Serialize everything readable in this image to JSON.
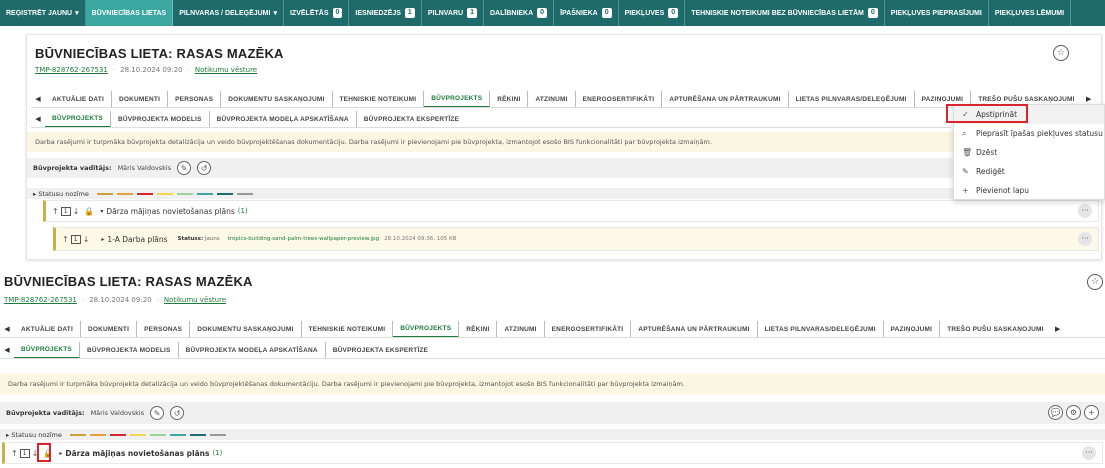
{
  "topnav": {
    "items": [
      {
        "label": "Reģistrēt jaunu",
        "caret": true
      },
      {
        "label": "Būvniecības lietas",
        "active": true
      },
      {
        "label": "Pilnvaras / deleģējumi",
        "caret": true
      },
      {
        "label": "Izvēlētās",
        "count": "0"
      },
      {
        "label": "Iesniedzējs",
        "count": "1"
      },
      {
        "label": "Pilnvaru",
        "count": "1"
      },
      {
        "label": "Dalībnieka",
        "count": "0"
      },
      {
        "label": "Īpašnieka",
        "count": "0"
      },
      {
        "label": "Piekļuves",
        "count": "0"
      },
      {
        "label": "Tehniskie noteikumi bez būvniecības lietām",
        "count": "0"
      },
      {
        "label": "Piekļuves pieprasījumi"
      },
      {
        "label": "Piekļuves lēmumi"
      }
    ],
    "caret_glyph": "▾"
  },
  "case": {
    "title": "Būvniecības lieta: Rasas Mazēka",
    "id": "TMP-828762-267531",
    "date": "28.10.2024 09:20",
    "history_link": "Notikumu vēsture",
    "sep": "·"
  },
  "tabs": {
    "main": [
      "Aktuālie dati",
      "Dokumenti",
      "Personas",
      "Dokumentu saskaņojumi",
      "Tehniskie noteikumi",
      "Būvprojekts",
      "Rēķini",
      "Atzinumi",
      "Energosertifikāti",
      "Apturēšana un pārtraukumi",
      "Lietas pilnvaras/deleģējumi",
      "Paziņojumi",
      "Trešo pušu saskaņojumi"
    ],
    "sub": [
      "Būvprojekts",
      "Būvprojekta modelis",
      "Būvprojekta modeļa apskatīšana",
      "Būvprojekta ekspertīze"
    ],
    "left_arrow": "◀",
    "right_arrow": "▶"
  },
  "info_text": "Darba rasējumi ir turpmāka būvprojekta detalizācija un veido būvprojektēšanas dokumentāciju. Darba rasējumi ir pievienojami pie būvprojekta, izmantojot esošo BIS funkcionalitāti par būvprojekta izmaiņām.",
  "manager": {
    "label": "Būvprojekta vadītājs:",
    "name": "Māris Valdovskis"
  },
  "legend": {
    "label": "▸ Statusu nozīme",
    "colors": [
      "#c9a23a",
      "#e8a13a",
      "#d9232d",
      "#f2d64b",
      "#9bd19b",
      "#3aa7a1",
      "#1f6b6b",
      "#999999"
    ]
  },
  "rows": {
    "folder": {
      "title": "Dārza mājiņas novietošanas plāns",
      "count": "(1)",
      "box": "1"
    },
    "file": {
      "title": "1-A Darba plāns",
      "status_label": "Statuss:",
      "status_value": "Jauns",
      "file_name": "tropics-building-sand-palm-trees-wallpaper-preview.jpg",
      "file_meta": "28.10.2024 09:36, 105 KB",
      "box": "1"
    }
  },
  "menu": {
    "items": [
      {
        "icon": "✓",
        "label": "Apstiprināt"
      },
      {
        "icon": "⌕",
        "label": "Pieprasīt īpašas piekļuves statusu"
      },
      {
        "icon": "🗑",
        "label": "Dzēst"
      },
      {
        "icon": "✎",
        "label": "Rediģēt"
      },
      {
        "icon": "+",
        "label": "Pievienot lapu"
      }
    ]
  },
  "glyphs": {
    "star": "☆",
    "dots": "···",
    "up": "↑",
    "down": "↓",
    "lock": "🔒",
    "tri_down": "▾",
    "tri_right": "▸",
    "edit": "✎",
    "history": "↺",
    "comment": "💬",
    "gear": "⚙",
    "plus": "+"
  },
  "highlight": {
    "color": "#d9232d"
  }
}
